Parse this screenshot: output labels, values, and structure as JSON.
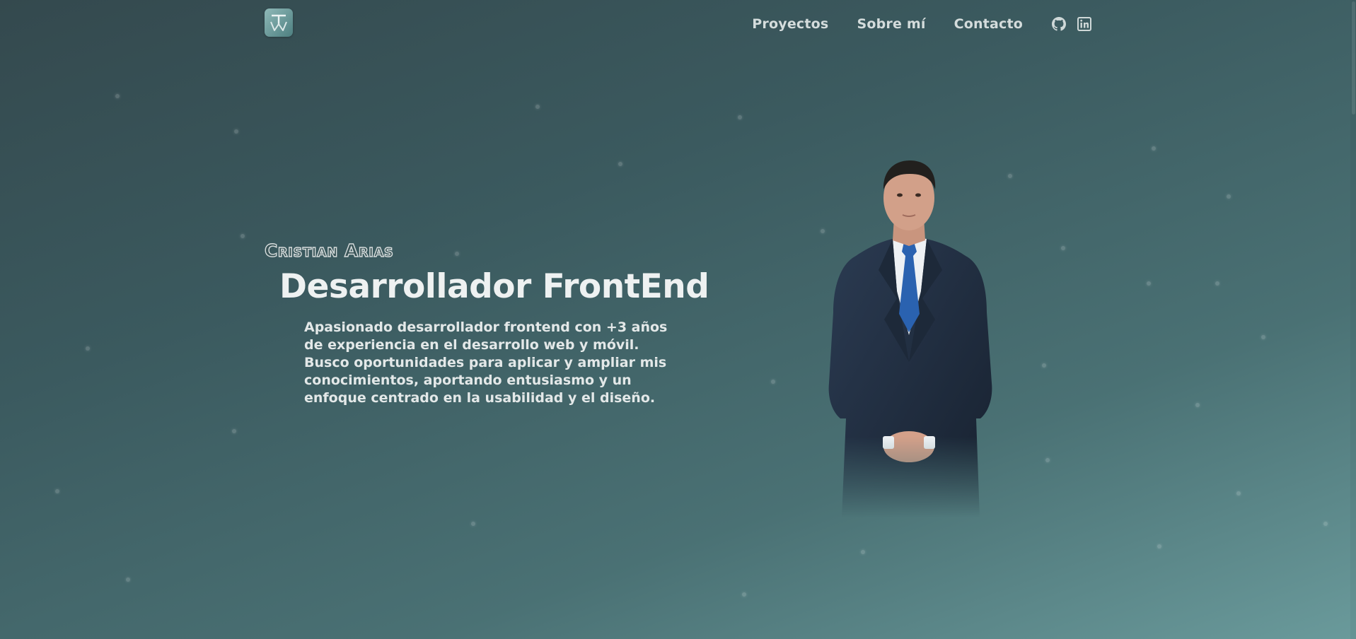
{
  "header": {
    "logo_icon": "monogram-logo-icon",
    "nav": [
      {
        "label": "Proyectos"
      },
      {
        "label": "Sobre mí"
      },
      {
        "label": "Contacto"
      }
    ],
    "social": [
      {
        "icon": "github-icon"
      },
      {
        "icon": "linkedin-icon"
      }
    ]
  },
  "hero": {
    "name": "Cristian Arias",
    "role": "Desarrollador FrontEnd",
    "intro_lines": [
      "Apasionado desarrollador frontend con +3 años",
      "de experiencia en el desarrollo web y móvil.",
      "Busco oportunidades para aplicar y ampliar mis",
      "conocimientos, aportando entusiasmo y un",
      "enfoque centrado en la usabilidad y el diseño."
    ],
    "portrait_icon": "profile-portrait"
  },
  "colors": {
    "background_start": "#34494e",
    "background_end": "#6a9a9b",
    "text": "#e9eeee"
  }
}
